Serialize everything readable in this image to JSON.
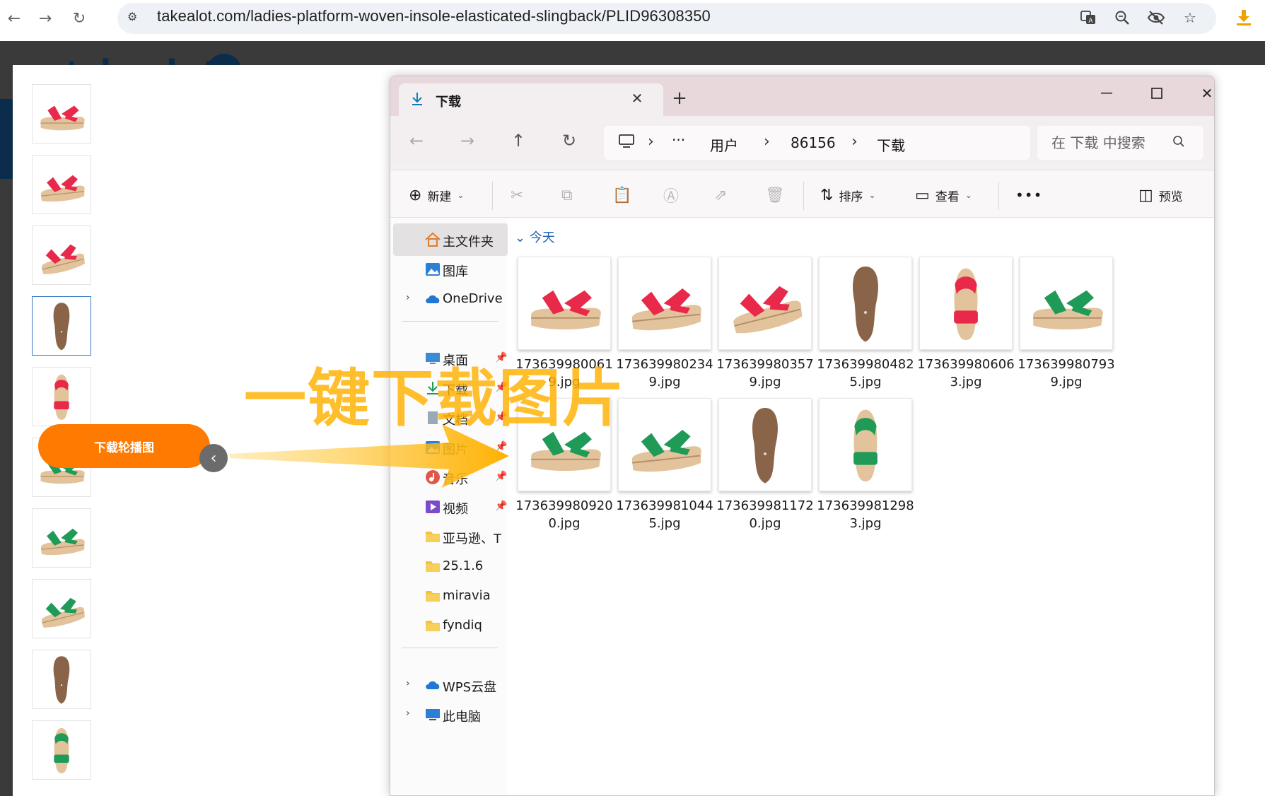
{
  "browser": {
    "url": "takealot.com/ladies-platform-woven-insole-elasticated-slingback/PLID96308350",
    "icons": [
      "back-icon",
      "forward-icon",
      "reload-icon",
      "site-settings-icon",
      "translate-icon",
      "zoom-icon",
      "eye-off-icon",
      "star-icon",
      "download-icon"
    ]
  },
  "page": {
    "thumbnails": [
      {
        "color": "red",
        "view": "side"
      },
      {
        "color": "red",
        "view": "angle"
      },
      {
        "color": "red",
        "view": "side2"
      },
      {
        "color": "brown",
        "view": "sole",
        "active": true
      },
      {
        "color": "red",
        "view": "front"
      },
      {
        "color": "green",
        "view": "side"
      },
      {
        "color": "green",
        "view": "angle"
      },
      {
        "color": "green",
        "view": "side2"
      },
      {
        "color": "brown",
        "view": "sole"
      },
      {
        "color": "green",
        "view": "front"
      }
    ],
    "download_button_label": "下载轮播图",
    "prev_glyph": "‹"
  },
  "explorer": {
    "tab_title": "下载",
    "new_tab_glyph": "+",
    "breadcrumb": {
      "ellipsis": "···",
      "items": [
        "用户",
        "86156",
        "下载"
      ]
    },
    "search_placeholder": "在 下载 中搜索",
    "toolbar": {
      "new_label": "新建",
      "sort_label": "排序",
      "view_label": "查看",
      "more_glyph": "•••",
      "preview_label": "预览"
    },
    "sidebar": {
      "items": [
        {
          "label": "主文件夹",
          "icon": "home-icon",
          "selected": true
        },
        {
          "label": "图库",
          "icon": "gallery-icon"
        },
        {
          "label": "OneDrive",
          "icon": "cloud-icon",
          "expandable": true
        },
        {
          "label": "桌面",
          "icon": "desktop-icon",
          "pinned": true
        },
        {
          "label": "下载",
          "icon": "download-icon",
          "pinned": true
        },
        {
          "label": "文档",
          "icon": "document-icon",
          "pinned": true
        },
        {
          "label": "图片",
          "icon": "pictures-icon",
          "pinned": true
        },
        {
          "label": "音乐",
          "icon": "music-icon",
          "pinned": true
        },
        {
          "label": "视频",
          "icon": "video-icon",
          "pinned": true
        },
        {
          "label": "亚马逊、T",
          "icon": "folder-icon"
        },
        {
          "label": "25.1.6",
          "icon": "folder-icon"
        },
        {
          "label": "miravia",
          "icon": "folder-icon"
        },
        {
          "label": "fyndiq",
          "icon": "folder-icon"
        },
        {
          "label": "WPS云盘",
          "icon": "cloud-icon",
          "expandable": true
        },
        {
          "label": "此电脑",
          "icon": "pc-icon",
          "expandable": true
        }
      ]
    },
    "group_label": "今天",
    "files": [
      {
        "name": "1736399800619.jpg",
        "color": "red",
        "view": "side"
      },
      {
        "name": "1736399802349.jpg",
        "color": "red",
        "view": "angle"
      },
      {
        "name": "1736399803579.jpg",
        "color": "red",
        "view": "side2"
      },
      {
        "name": "1736399804825.jpg",
        "color": "brown",
        "view": "sole"
      },
      {
        "name": "1736399806063.jpg",
        "color": "red",
        "view": "front"
      },
      {
        "name": "1736399807939.jpg",
        "color": "green",
        "view": "side"
      },
      {
        "name": "1736399809200.jpg",
        "color": "green",
        "view": "side"
      },
      {
        "name": "1736399810445.jpg",
        "color": "green",
        "view": "angle"
      },
      {
        "name": "1736399811720.jpg",
        "color": "brown",
        "view": "sole"
      },
      {
        "name": "1736399812983.jpg",
        "color": "green",
        "view": "front"
      }
    ]
  },
  "overlay_text": "一键下载图片",
  "colors": {
    "red": "#e8294a",
    "green": "#1f9a57",
    "brown": "#8a6448",
    "cork": "#e2c39c",
    "orange": "#ff7a00",
    "overlay": "#ffb100"
  }
}
